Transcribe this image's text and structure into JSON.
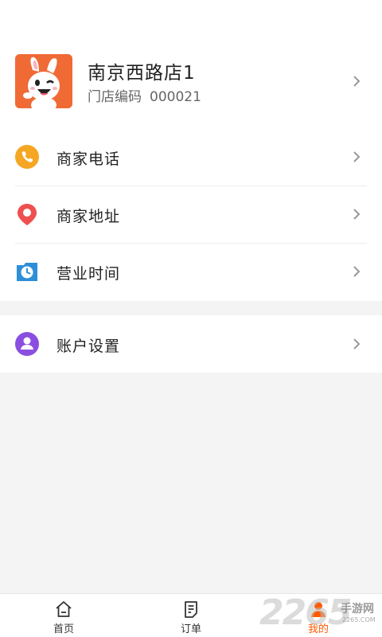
{
  "store": {
    "name": "南京西路店1",
    "code_label": "门店编码",
    "code_value": "000021"
  },
  "menu": [
    {
      "label": "商家电话",
      "icon": "phone-icon",
      "color": "#f5a623"
    },
    {
      "label": "商家地址",
      "icon": "location-pin-icon",
      "color": "#ef4f4f"
    },
    {
      "label": "营业时间",
      "icon": "clock-icon",
      "color": "#2d8fd8"
    }
  ],
  "account": {
    "label": "账户设置",
    "icon": "user-icon",
    "color": "#8a4fe0"
  },
  "tabbar": {
    "tabs": [
      {
        "label": "首页",
        "icon": "home-icon"
      },
      {
        "label": "订单",
        "icon": "orders-icon"
      },
      {
        "label": "我的",
        "icon": "profile-icon",
        "active": true
      }
    ]
  },
  "watermark": {
    "digits": "2265",
    "text": "手游网",
    "sub": "2265.COM"
  },
  "colors": {
    "accent": "#ff5a00",
    "background": "#f4f4f4"
  }
}
